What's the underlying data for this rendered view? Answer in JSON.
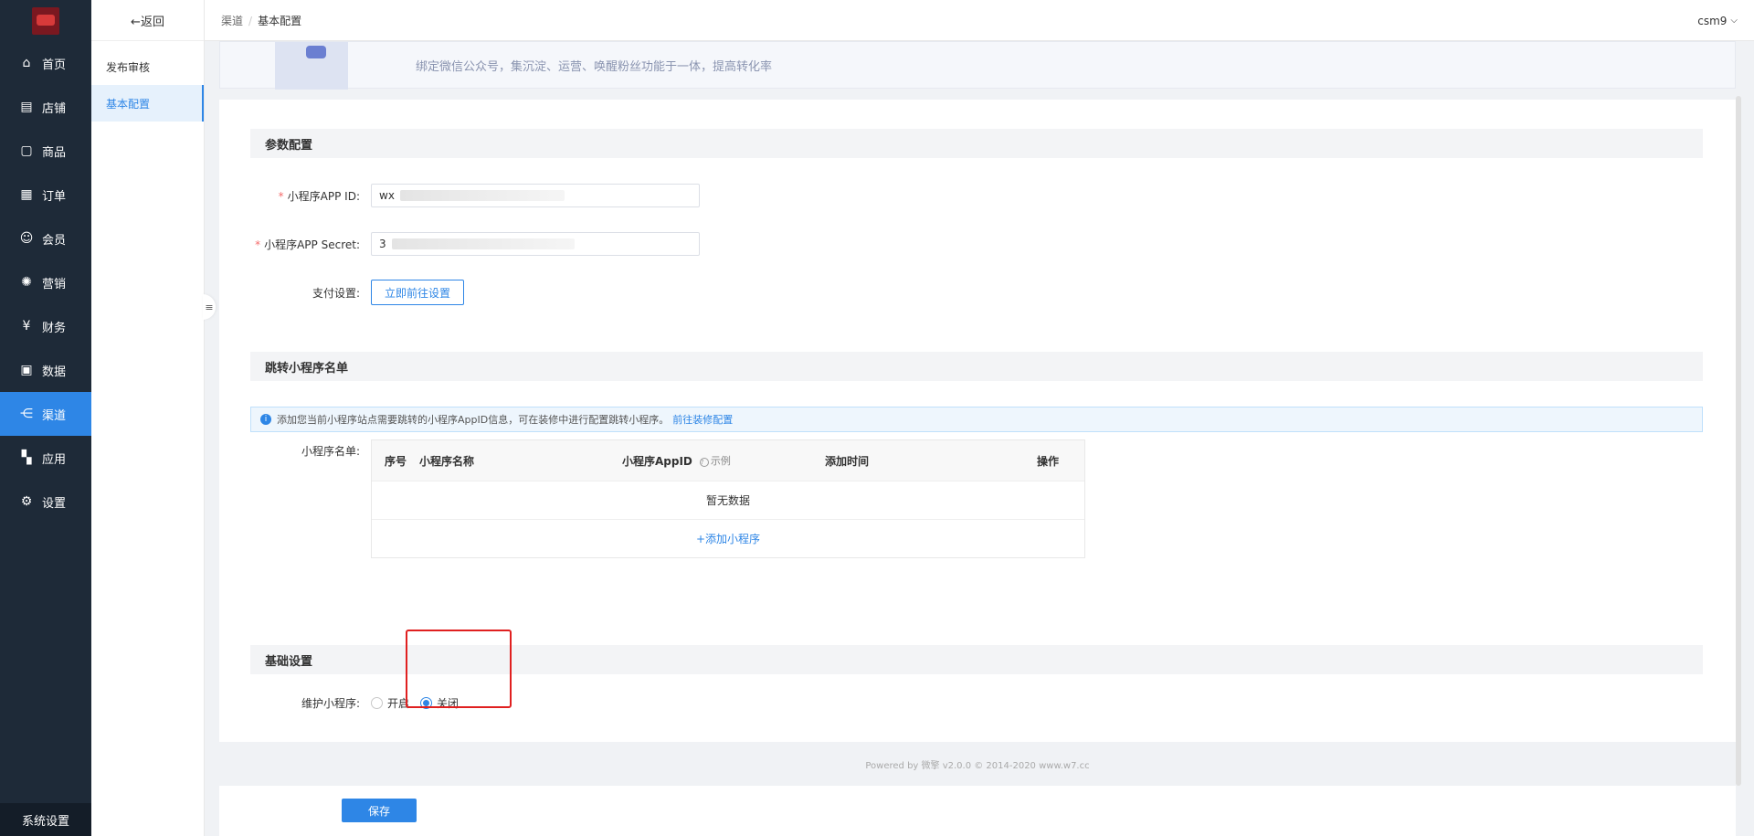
{
  "nav": {
    "items": [
      {
        "label": "首页",
        "icon": "home-icon",
        "glyph": "⌂"
      },
      {
        "label": "店铺",
        "icon": "store-icon",
        "glyph": "▤"
      },
      {
        "label": "商品",
        "icon": "goods-icon",
        "glyph": "▢"
      },
      {
        "label": "订单",
        "icon": "order-icon",
        "glyph": "▦"
      },
      {
        "label": "会员",
        "icon": "member-icon",
        "glyph": "☺"
      },
      {
        "label": "营销",
        "icon": "marketing-icon",
        "glyph": "✺"
      },
      {
        "label": "财务",
        "icon": "finance-icon",
        "glyph": "¥"
      },
      {
        "label": "数据",
        "icon": "data-icon",
        "glyph": "▣"
      },
      {
        "label": "渠道",
        "icon": "channel-icon",
        "glyph": "⋲"
      },
      {
        "label": "应用",
        "icon": "app-icon",
        "glyph": "▚"
      },
      {
        "label": "设置",
        "icon": "settings-icon",
        "glyph": "⚙"
      }
    ],
    "active": "渠道",
    "bottom_label": "系统设置"
  },
  "subnav": {
    "back_label": "←返回",
    "items": [
      {
        "label": "发布审核"
      },
      {
        "label": "基本配置"
      }
    ],
    "active": "基本配置"
  },
  "header": {
    "breadcrumb": [
      "渠道",
      "基本配置"
    ],
    "user": "csm9",
    "user_caret": "⌵"
  },
  "banner": {
    "text": "绑定微信公众号，集沉淀、运营、唤醒粉丝功能于一体，提高转化率"
  },
  "params": {
    "title": "参数配置",
    "appid_label": "小程序APP ID:",
    "appid_value": "wx",
    "secret_label": "小程序APP Secret:",
    "secret_value": "3",
    "pay_label": "支付设置:",
    "pay_button": "立即前往设置",
    "required_mark": "*"
  },
  "jump": {
    "title": "跳转小程序名单",
    "info_icon": "i",
    "info_text": "添加您当前小程序站点需要跳转的小程序AppID信息，可在装修中进行配置跳转小程序。",
    "info_link": "前往装修配置",
    "list_label": "小程序名单:",
    "columns": [
      "序号",
      "小程序名称",
      "小程序AppID",
      "添加时间",
      "操作"
    ],
    "question_glyph": "?",
    "example_label": "示例",
    "empty_text": "暂无数据",
    "add_label": "+添加小程序"
  },
  "basic": {
    "title": "基础设置",
    "maintain_label": "维护小程序:",
    "options": [
      "开启",
      "关闭"
    ],
    "selected": "关闭"
  },
  "footer": {
    "text": "Powered by 微擎 v2.0.0 © 2014-2020 www.w7.cc"
  },
  "actions": {
    "save_label": "保存"
  },
  "colors": {
    "primary": "#2e86e6",
    "nav_bg": "#1e2a38",
    "highlight": "#e02020"
  }
}
